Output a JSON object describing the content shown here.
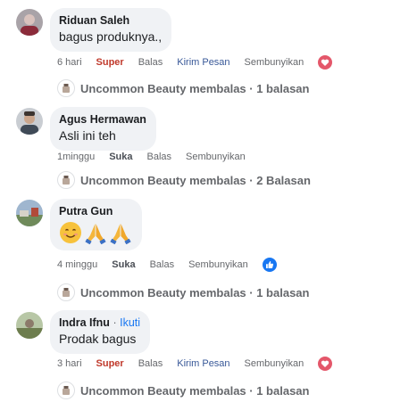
{
  "comments": [
    {
      "author": "Riduan Saleh",
      "text": "bagus produknya.,",
      "time": "6 hari",
      "reaction_label": "Super",
      "actions": [
        "Balas",
        "Kirim Pesan",
        "Sembunyikan"
      ],
      "page_reaction_icon": "heart-icon",
      "reply_summary": "Uncommon Beauty membalas · 1 balasan"
    },
    {
      "author": "Agus Hermawan",
      "text": "Asli ini teh",
      "time": "1minggu",
      "reaction_label": "Suka",
      "actions": [
        "Balas",
        "Sembunyikan"
      ],
      "reply_summary": "Uncommon Beauty membalas · 2 Balasan"
    },
    {
      "author": "Putra Gun",
      "emojis": [
        "smiling-face-emoji",
        "folded-hands-emoji",
        "folded-hands-emoji"
      ],
      "time": "4 minggu",
      "reaction_label": "Suka",
      "actions": [
        "Balas",
        "Sembunyikan"
      ],
      "page_reaction_icon": "like-icon",
      "reply_summary": "Uncommon Beauty membalas · 1 balasan"
    },
    {
      "author": "Indra Ifnu",
      "author_separator": "·",
      "follow_label": "Ikuti",
      "text": "Prodak bagus",
      "time": "3 hari",
      "reaction_label": "Super",
      "actions": [
        "Balas",
        "Kirim Pesan",
        "Sembunyikan"
      ],
      "page_reaction_icon": "heart-icon",
      "reply_summary": "Uncommon Beauty membalas · 1 balasan"
    }
  ],
  "colors": {
    "bubble": "#f0f2f5",
    "super": "#c0392b",
    "link": "#385898",
    "follow": "#1877f2",
    "heart": "#e4576a",
    "like": "#1877f2"
  }
}
